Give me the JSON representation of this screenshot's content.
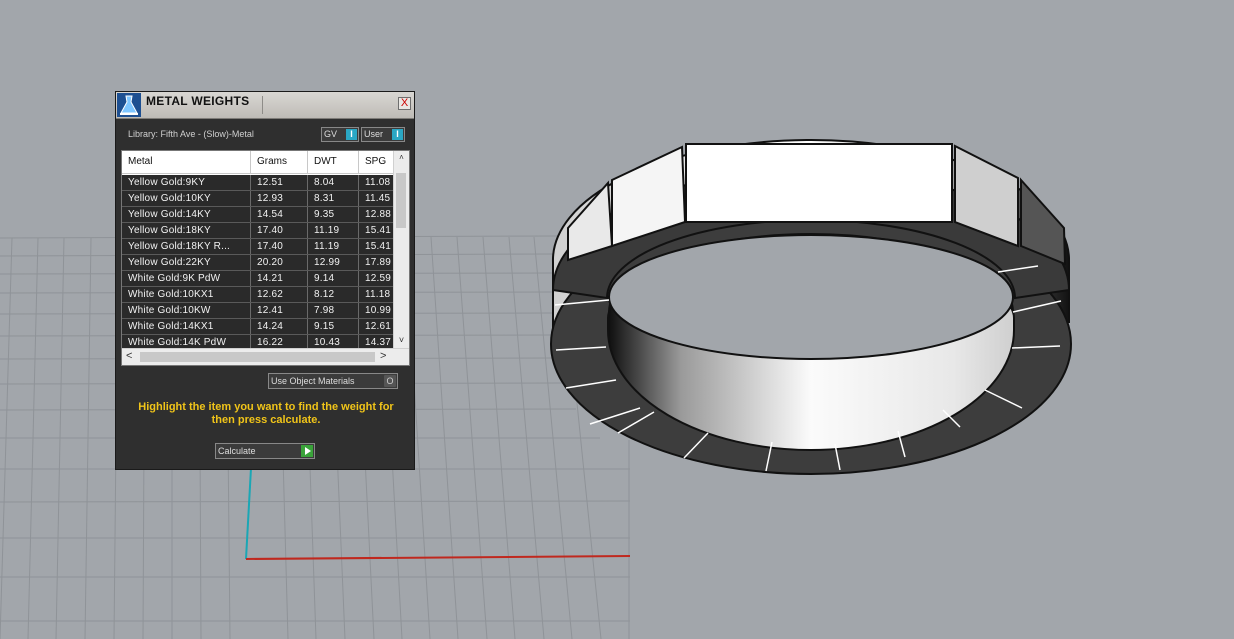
{
  "panel": {
    "title": "METAL WEIGHTS",
    "close_label": "X",
    "library_label": "Library: Fifth Ave - (Slow)-Metal",
    "toggles": [
      {
        "label": "GV",
        "knob": "I"
      },
      {
        "label": "User",
        "knob": "I"
      }
    ],
    "table": {
      "headers": [
        "Metal",
        "Grams",
        "DWT",
        "SPG"
      ],
      "rows": [
        [
          "Yellow Gold:9KY",
          "12.51",
          "8.04",
          "11.08"
        ],
        [
          "Yellow Gold:10KY",
          "12.93",
          "8.31",
          "11.45"
        ],
        [
          "Yellow Gold:14KY",
          "14.54",
          "9.35",
          "12.88"
        ],
        [
          "Yellow Gold:18KY",
          "17.40",
          "11.19",
          "15.41"
        ],
        [
          "Yellow Gold:18KY R...",
          "17.40",
          "11.19",
          "15.41"
        ],
        [
          "Yellow Gold:22KY",
          "20.20",
          "12.99",
          "17.89"
        ],
        [
          "White Gold:9K PdW",
          "14.21",
          "9.14",
          "12.59"
        ],
        [
          "White Gold:10KX1",
          "12.62",
          "8.12",
          "11.18"
        ],
        [
          "White Gold:10KW",
          "12.41",
          "7.98",
          "10.99"
        ],
        [
          "White Gold:14KX1",
          "14.24",
          "9.15",
          "12.61"
        ],
        [
          "White Gold:14K PdW",
          "16.22",
          "10.43",
          "14.37"
        ]
      ]
    },
    "scroll": {
      "up": "˄",
      "down": "˅",
      "left": "<",
      "right": ">"
    },
    "use_object_materials": "Use Object Materials",
    "use_object_knob": "O",
    "instructions": "Highlight the item you want to find the weight for then press calculate.",
    "calculate_label": "Calculate"
  },
  "colors": {
    "viewport_bg": "#a2a6ab",
    "grid_line": "#8f9398",
    "x_axis": "#c0281e",
    "y_axis": "#1aa7b5",
    "panel_bg": "#2f2f2f",
    "instruction_text": "#f0c419",
    "toggle_knob": "#2aa7c4",
    "calc_play": "#3aa33a"
  },
  "icons": {
    "app_logo": "flask-logo-icon",
    "close": "close-icon",
    "calculate": "play-icon"
  }
}
